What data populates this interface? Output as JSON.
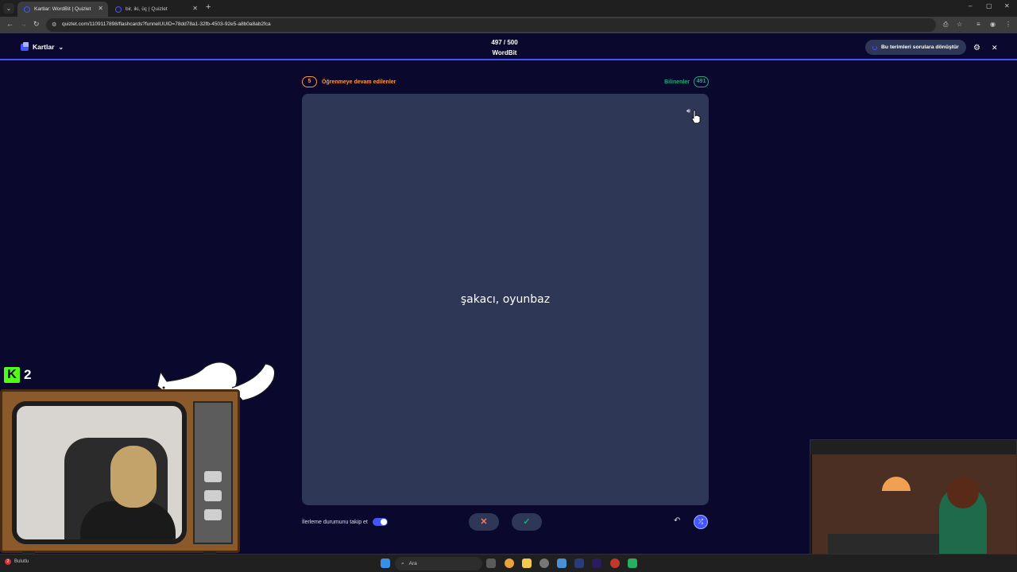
{
  "browser": {
    "tabs": [
      {
        "title": "Kartlar: WordBit | Quizlet",
        "active": true
      },
      {
        "title": "bir, iki, üç | Quizlet",
        "active": false
      }
    ],
    "new_tab": "+",
    "url": "quizlet.com/1109117898/flashcards?funnelUUID=78dd78a1-32fb-4503-92e5-a8b0a8ab2fca",
    "nav": {
      "back": "←",
      "forward": "→",
      "reload": "↻"
    },
    "window": {
      "minimize": "–",
      "maximize": "▢",
      "close": "✕"
    }
  },
  "header": {
    "mode_label": "Kartlar",
    "progress": "497 / 500",
    "set_title": "WordBit",
    "convert_button": "Bu terimleri sorulara dönüştür"
  },
  "study": {
    "still_learning_count": "5",
    "still_learning_label": "Öğrenmeye devam edilenler",
    "known_label": "Bilinenler",
    "known_count": "491",
    "term": "şakacı, oyunbaz",
    "track_progress_label": "İlerleme durumunu takip et",
    "wrong_symbol": "✕",
    "right_symbol": "✓",
    "undo_symbol": "↶",
    "shuffle_symbol": "⤮"
  },
  "overlay": {
    "kick_logo": "K",
    "kick_count": "2"
  },
  "taskbar": {
    "search_label": "Ara",
    "notification_count": "2",
    "weather_text": "Bulutlu"
  },
  "colors": {
    "background": "#0a092d",
    "card": "#2e3856",
    "accent": "#4255ff",
    "still_learning": "#ff983a",
    "known": "#18ae79"
  }
}
